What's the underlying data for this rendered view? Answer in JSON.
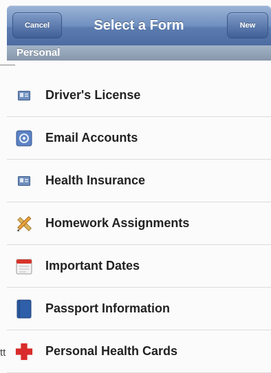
{
  "navbar": {
    "cancel_label": "Cancel",
    "title": "Select a Form",
    "new_label": "New"
  },
  "section": {
    "title": "Personal"
  },
  "forms": [
    {
      "label": "Driver's License",
      "icon": "id-card-icon"
    },
    {
      "label": "Email Accounts",
      "icon": "email-icon"
    },
    {
      "label": "Health Insurance",
      "icon": "id-card-icon"
    },
    {
      "label": "Homework Assignments",
      "icon": "pencil-ruler-icon"
    },
    {
      "label": "Important Dates",
      "icon": "calendar-icon"
    },
    {
      "label": "Passport Information",
      "icon": "passport-icon"
    },
    {
      "label": "Personal Health Cards",
      "icon": "red-cross-icon"
    }
  ],
  "edge_text": "tt",
  "colors": {
    "navbar": "#5c7cb0",
    "section_header": "#8797ab",
    "cross_red": "#d92b2b"
  }
}
